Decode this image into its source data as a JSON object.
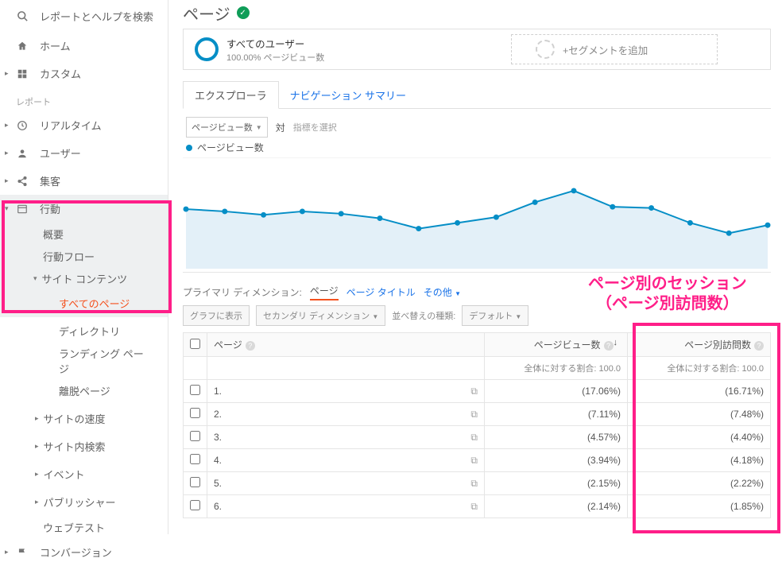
{
  "sidebar": {
    "search_placeholder": "レポートとヘルプを検索",
    "home": "ホーム",
    "custom": "カスタム",
    "reports_label": "レポート",
    "realtime": "リアルタイム",
    "user": "ユーザー",
    "acquisition": "集客",
    "behavior": "行動",
    "behavior_items": {
      "overview": "概要",
      "behavior_flow": "行動フロー",
      "site_content": "サイト コンテンツ",
      "all_pages": "すべてのページ",
      "directory": "ディレクトリ",
      "landing_pages": "ランディング ページ",
      "exit_pages": "離脱ページ",
      "site_speed": "サイトの速度",
      "site_search": "サイト内検索",
      "events": "イベント",
      "publisher": "パブリッシャー",
      "webtest": "ウェブテスト"
    },
    "conversion": "コンバージョン"
  },
  "header": {
    "title": "ページ"
  },
  "segments": {
    "all_users": "すべてのユーザー",
    "all_users_sub": "100.00% ページビュー数",
    "add_segment": "+セグメントを追加"
  },
  "tabs": {
    "explorer": "エクスプローラ",
    "nav_summary": "ナビゲーション サマリー"
  },
  "metric": {
    "selector": "ページビュー数",
    "vs": "対",
    "pick": "指標を選択",
    "legend": "ページビュー数"
  },
  "chart_data": {
    "type": "line",
    "title": "",
    "xlabel": "",
    "ylabel": "",
    "series": [
      {
        "name": "ページビュー数",
        "values": [
          52,
          50,
          47,
          50,
          48,
          44,
          35,
          40,
          45,
          58,
          68,
          54,
          53,
          40,
          31,
          38
        ]
      }
    ],
    "x": [
      1,
      2,
      3,
      4,
      5,
      6,
      7,
      8,
      9,
      10,
      11,
      12,
      13,
      14,
      15,
      16
    ],
    "ylim": [
      0,
      80
    ]
  },
  "dimension": {
    "label": "プライマリ ディメンション:",
    "page": "ページ",
    "page_title": "ページ タイトル",
    "other": "その他"
  },
  "toolbar": {
    "chart_toggle": "グラフに表示",
    "secondary_dim": "セカンダリ ディメンション",
    "sort_label": "並べ替えの種類:",
    "sort_default": "デフォルト"
  },
  "table": {
    "col_page": "ページ",
    "col_pv": "ページビュー数",
    "col_sessions": "ページ別訪問数",
    "summary_label": "全体に対する割合: 100.0",
    "rows": [
      {
        "idx": "1.",
        "pv_pct": "(17.06%)",
        "s_pct": "(16.71%)"
      },
      {
        "idx": "2.",
        "pv_pct": "(7.11%)",
        "s_pct": "(7.48%)"
      },
      {
        "idx": "3.",
        "pv_pct": "(4.57%)",
        "s_pct": "(4.40%)"
      },
      {
        "idx": "4.",
        "pv_pct": "(3.94%)",
        "s_pct": "(4.18%)"
      },
      {
        "idx": "5.",
        "pv_pct": "(2.15%)",
        "s_pct": "(2.22%)"
      },
      {
        "idx": "6.",
        "pv_pct": "(2.14%)",
        "s_pct": "(1.85%)"
      }
    ]
  },
  "annotation": {
    "line1": "ページ別のセッション",
    "line2": "（ページ別訪問数）"
  }
}
